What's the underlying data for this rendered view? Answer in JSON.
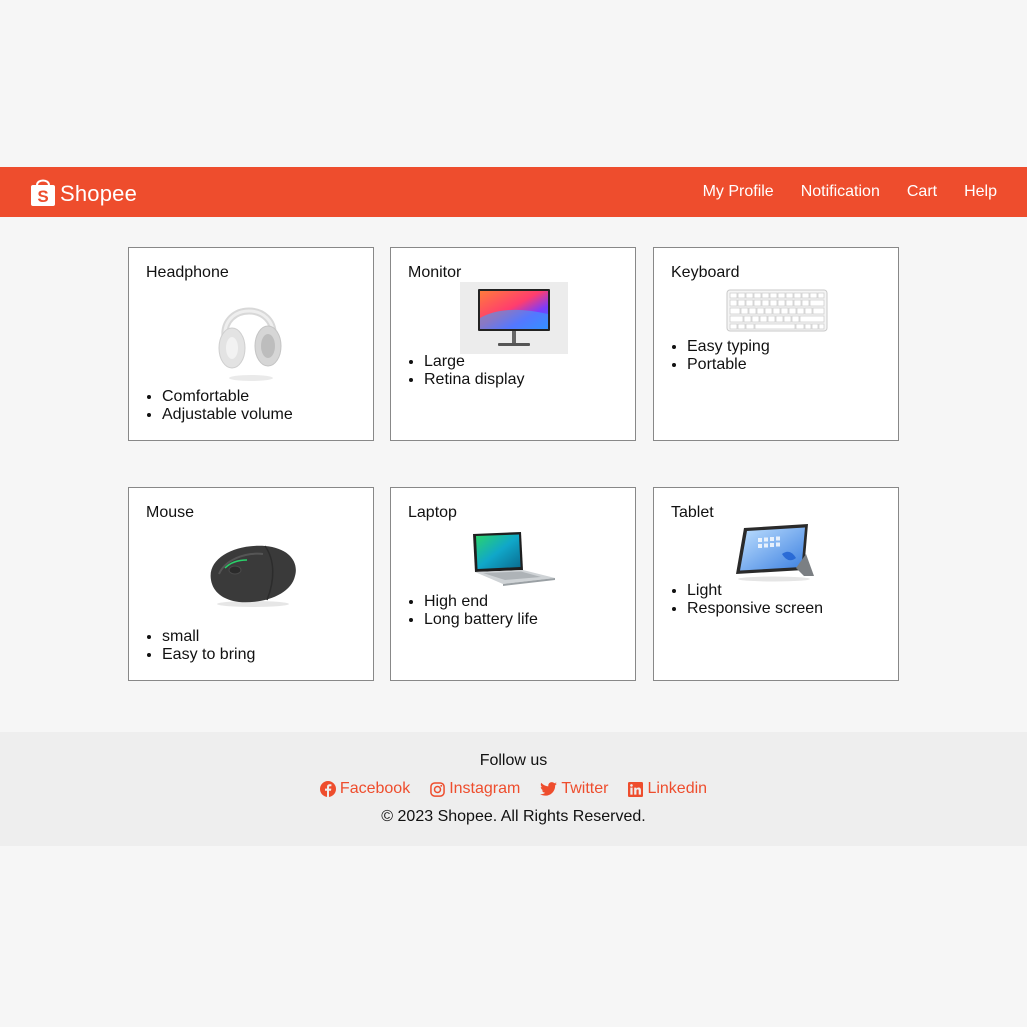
{
  "brand": {
    "name": "Shopee",
    "color": "#ee4d2d"
  },
  "nav": {
    "items": [
      {
        "label": "My Profile"
      },
      {
        "label": "Notification"
      },
      {
        "label": "Cart"
      },
      {
        "label": "Help"
      }
    ]
  },
  "products": [
    {
      "title": "Headphone",
      "image": "headphone-image",
      "features": [
        "Comfortable",
        "Adjustable volume"
      ]
    },
    {
      "title": "Monitor",
      "image": "monitor-image",
      "features": [
        "Large",
        "Retina display"
      ]
    },
    {
      "title": "Keyboard",
      "image": "keyboard-image",
      "features": [
        "Easy typing",
        "Portable"
      ]
    },
    {
      "title": "Mouse",
      "image": "mouse-image",
      "features": [
        "small",
        "Easy to bring"
      ]
    },
    {
      "title": "Laptop",
      "image": "laptop-image",
      "features": [
        "High end",
        "Long battery life"
      ]
    },
    {
      "title": "Tablet",
      "image": "tablet-image",
      "features": [
        "Light",
        "Responsive screen"
      ]
    }
  ],
  "footer": {
    "follow_label": "Follow us",
    "socials": [
      {
        "label": "Facebook",
        "icon": "facebook-icon"
      },
      {
        "label": "Instagram",
        "icon": "instagram-icon"
      },
      {
        "label": "Twitter",
        "icon": "twitter-icon"
      },
      {
        "label": "Linkedin",
        "icon": "linkedin-icon"
      }
    ],
    "copyright": "© 2023 Shopee. All Rights Reserved."
  }
}
